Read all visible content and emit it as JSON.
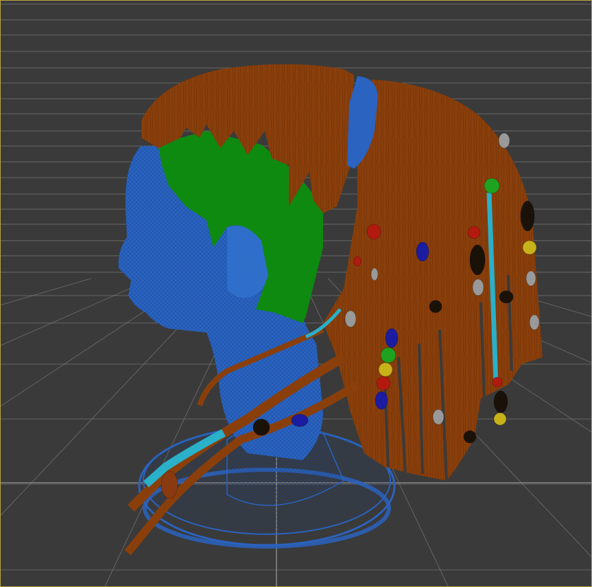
{
  "viewport": {
    "name": "perspective-viewport",
    "border_color": "#b9a642",
    "background_color": "#3a3a3a",
    "grid_color": "#8f8f8f"
  },
  "model": {
    "head_color": "#2a63c0",
    "hair_color": "#8a3f0b",
    "scalp_color": "#0e8a10",
    "band_color": "#2a63c0",
    "cyan_strand_color": "#2ab0c8",
    "bead_colors": [
      "#b21a10",
      "#1c1ca0",
      "#1a1208",
      "#999999",
      "#1fa21f",
      "#c8b21a",
      "#8a3a10"
    ]
  }
}
